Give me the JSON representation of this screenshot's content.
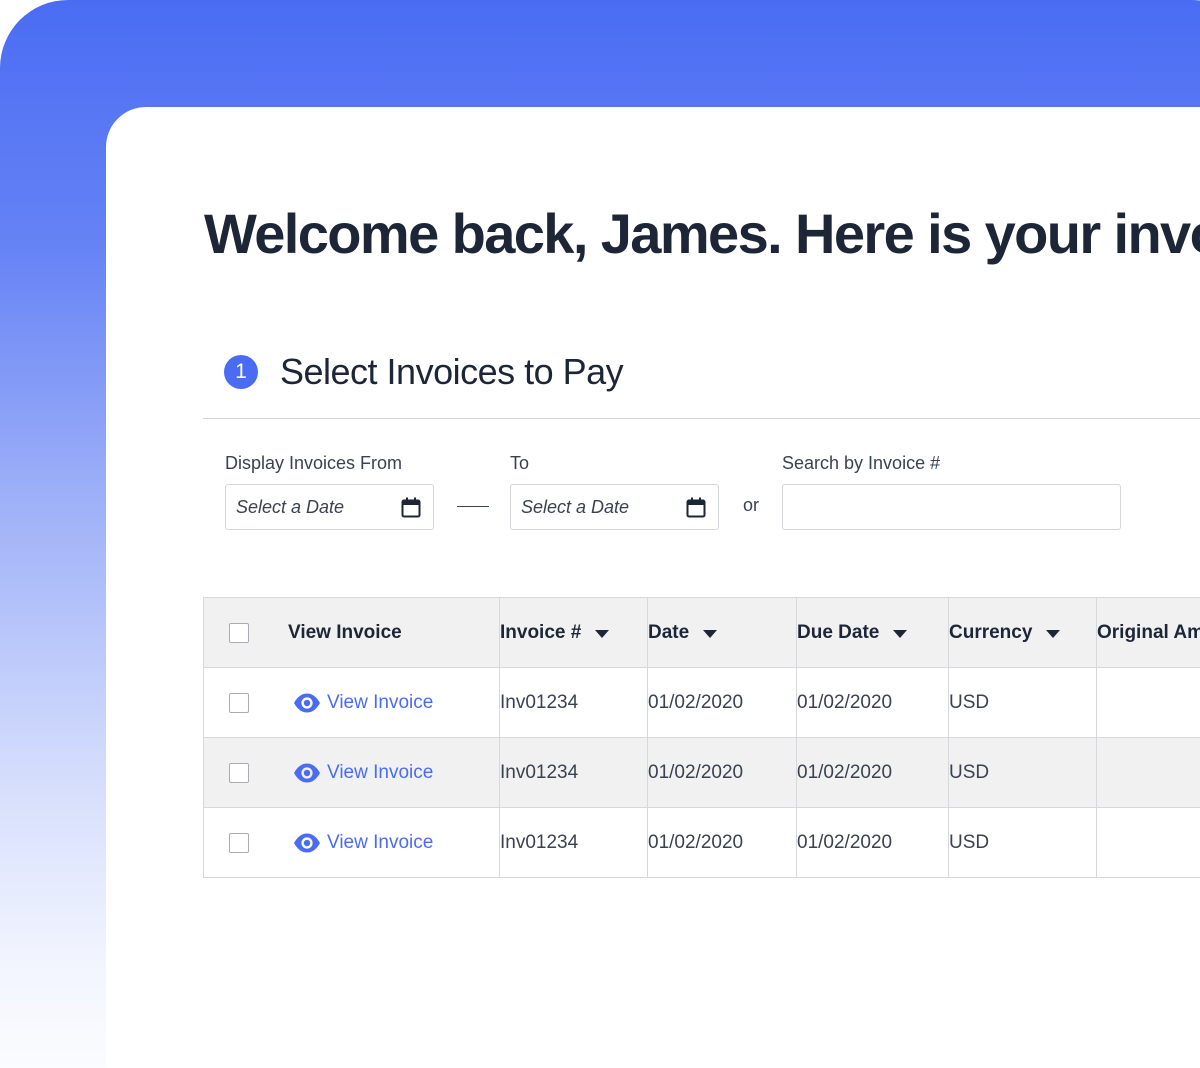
{
  "heading": "Welcome back, James. Here is your invoice",
  "step": {
    "number": "1",
    "title": "Select Invoices to Pay"
  },
  "filters": {
    "from_label": "Display Invoices From",
    "from_placeholder": "Select a Date",
    "to_label": "To",
    "to_placeholder": "Select a Date",
    "or_text": "or",
    "search_label": "Search by Invoice #",
    "search_value": ""
  },
  "table": {
    "headers": {
      "view": "View Invoice",
      "invoice": "Invoice #",
      "date": "Date",
      "due": "Due Date",
      "currency": "Currency",
      "original": "Original Amount"
    },
    "rows": [
      {
        "link": "View Invoice",
        "invoice": "Inv01234",
        "date": "01/02/2020",
        "due": "01/02/2020",
        "currency": "USD",
        "original": ""
      },
      {
        "link": "View Invoice",
        "invoice": "Inv01234",
        "date": "01/02/2020",
        "due": "01/02/2020",
        "currency": "USD",
        "original": ""
      },
      {
        "link": "View Invoice",
        "invoice": "Inv01234",
        "date": "01/02/2020",
        "due": "01/02/2020",
        "currency": "USD",
        "original": ""
      }
    ]
  },
  "colors": {
    "accent": "#4a6cf3",
    "row_alt": "#f1f1f1",
    "border": "#d6d8dc"
  },
  "icons": {
    "date_picker": "calendar-icon",
    "view": "eye-icon",
    "sort": "caret-down-icon"
  }
}
